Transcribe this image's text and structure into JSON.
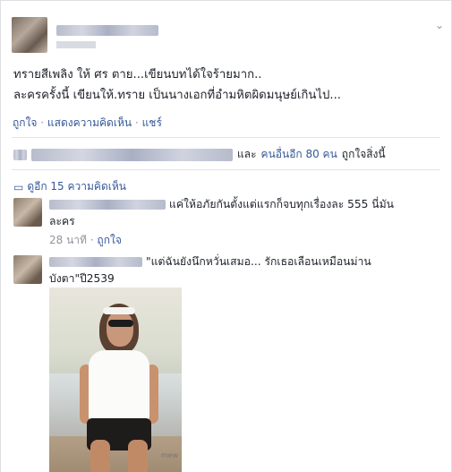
{
  "post": {
    "text_line1": "ทรายสีเพลิง ให้ ศร ตาย...เขียนบทได้ใจร้ายมาก..",
    "text_line2": "ละครครั้งนี้ เขียนให้.ทราย เป็นนางเอกที่อำมหิตผิดมนุษย์เกินไป...",
    "menu_icon": "chevron-down-icon"
  },
  "actions": {
    "like": "ถูกใจ",
    "comment": "แสดงความคิดเห็น",
    "share": "แชร์",
    "separator": "·"
  },
  "likes_summary": {
    "and": "และ",
    "others": "คนอื่นอีก 80 คน",
    "liked": "ถูกใจสิ่งนี้"
  },
  "view_more": "ดูอีก 15 ความคิดเห็น",
  "comments": [
    {
      "text_line1": "แค่ให้อภัยกันตั้งแต่แรกก็จบทุกเรื่องละ 555 นี่มัน",
      "text_line2": "ละคร",
      "time": "28 นาที",
      "like": "ถูกใจ"
    },
    {
      "text_line1": "\"แต่ฉันยังนึกหวั่นเสมอ... รักเธอเลือนเหมือนม่าน",
      "text_line2": "บังตา\"ปี2539",
      "photo_watermark": "mew"
    }
  ]
}
